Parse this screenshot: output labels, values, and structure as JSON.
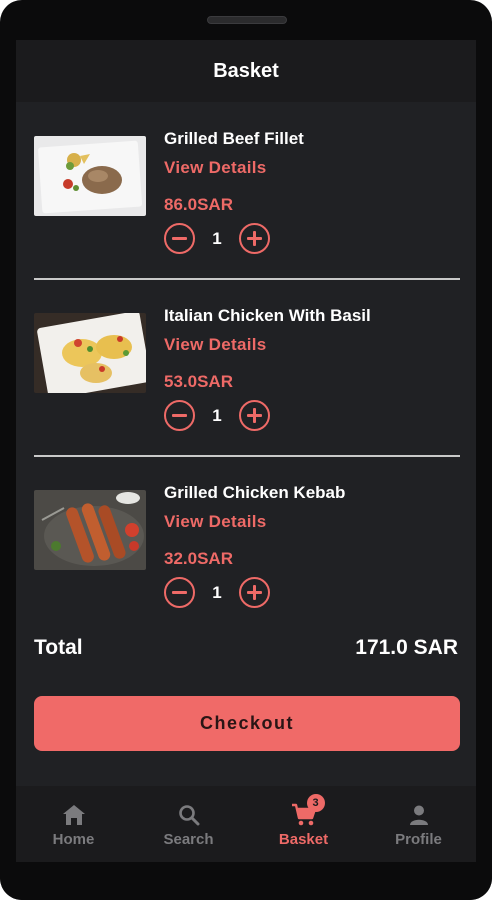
{
  "header": {
    "title": "Basket"
  },
  "items": [
    {
      "name": "Grilled Beef Fillet",
      "link": "View Details",
      "price": "86.0SAR",
      "quantity": "1",
      "image": "grilled-beef-fillet-photo"
    },
    {
      "name": "Italian Chicken With Basil",
      "link": "View Details",
      "price": "53.0SAR",
      "quantity": "1",
      "image": "italian-chicken-basil-photo"
    },
    {
      "name": "Grilled Chicken Kebab",
      "link": "View Details",
      "price": "32.0SAR",
      "quantity": "1",
      "image": "grilled-chicken-kebab-photo"
    }
  ],
  "summary": {
    "total_label": "Total",
    "total_value": "171.0 SAR"
  },
  "checkout": {
    "label": "Checkout"
  },
  "nav": {
    "items": [
      {
        "label": "Home",
        "icon": "home-icon"
      },
      {
        "label": "Search",
        "icon": "search-icon"
      },
      {
        "label": "Basket",
        "icon": "cart-icon",
        "badge": "3",
        "active": true
      },
      {
        "label": "Profile",
        "icon": "person-icon"
      }
    ]
  },
  "colors": {
    "accent": "#ee6a67",
    "background": "#202124",
    "bar": "#1b1b1d",
    "button": "#f06a68"
  }
}
